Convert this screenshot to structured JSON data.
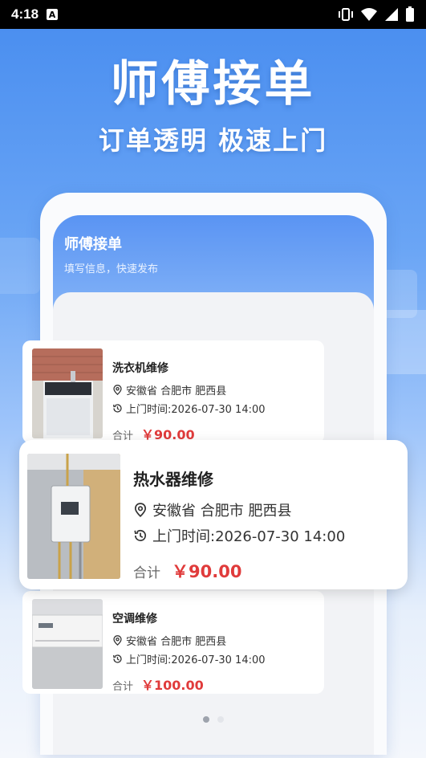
{
  "status_bar": {
    "time": "4:18",
    "badge": "A"
  },
  "hero": {
    "title": "师傅接单",
    "subtitle": "订单透明 极速上门"
  },
  "panel": {
    "title": "师傅接单",
    "subtitle": "填写信息，快速发布"
  },
  "orders": [
    {
      "name": "洗衣机维修",
      "location": "安徽省 合肥市 肥西县",
      "time": "上门时间:2026-07-30 14:00",
      "total_label": "合计",
      "price": "￥90.00",
      "image_icon": "washing-machine"
    },
    {
      "name": "热水器维修",
      "location": "安徽省 合肥市 肥西县",
      "time": "上门时间:2026-07-30 14:00",
      "total_label": "合计",
      "price": "￥90.00",
      "image_icon": "water-heater"
    },
    {
      "name": "空调维修",
      "location": "安徽省 合肥市 肥西县",
      "time": "上门时间:2026-07-30 14:00",
      "total_label": "合计",
      "price": "￥100.00",
      "image_icon": "air-conditioner"
    }
  ],
  "carousel": {
    "pages": 2,
    "active_page": 1
  },
  "colors": {
    "accent": "#4b8ff0",
    "price": "#e03b3b"
  }
}
